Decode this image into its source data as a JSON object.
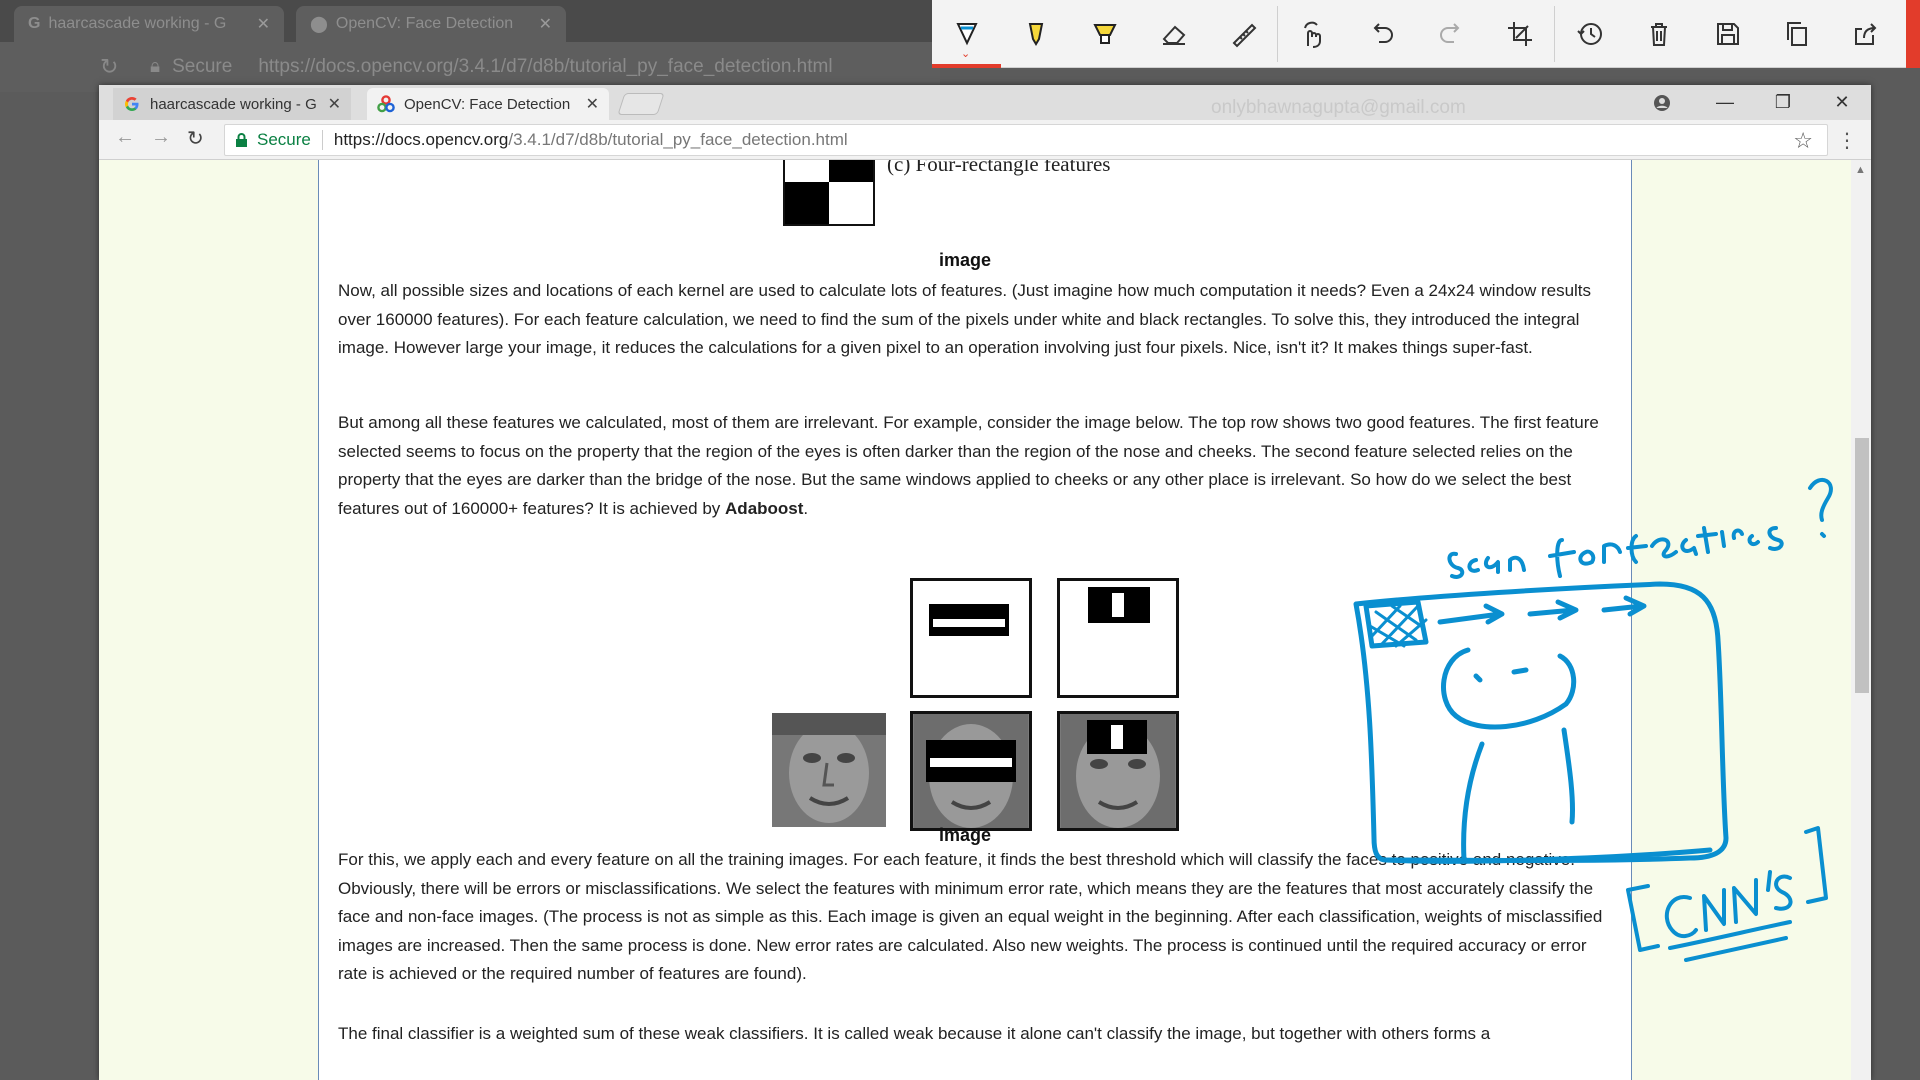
{
  "background_browser": {
    "tabs": [
      {
        "title": "haarcascade working - G"
      },
      {
        "title": "OpenCV: Face Detection"
      }
    ],
    "secure_label": "Secure",
    "url": "https://docs.opencv.org/3.4.1/d7/d8b/tutorial_py_face_detection.html"
  },
  "toolbar": {
    "tools": [
      {
        "icon": "pen-icon",
        "active": true
      },
      {
        "icon": "pencil-highlighter-icon"
      },
      {
        "icon": "highlighter-icon"
      },
      {
        "icon": "eraser-icon"
      },
      {
        "icon": "ruler-icon"
      },
      {
        "icon": "touch-writing-icon"
      },
      {
        "icon": "undo-icon"
      },
      {
        "icon": "redo-icon"
      },
      {
        "icon": "crop-icon"
      },
      {
        "icon": "history-icon"
      },
      {
        "icon": "delete-icon"
      },
      {
        "icon": "save-icon"
      },
      {
        "icon": "copy-icon"
      },
      {
        "icon": "share-icon"
      }
    ],
    "accent_color": "#e23c2b"
  },
  "browser": {
    "tabs": [
      {
        "title": "haarcascade working - G",
        "active": false
      },
      {
        "title": "OpenCV: Face Detection",
        "active": true
      }
    ],
    "profile_email": "onlybhawnagupta@gmail.com",
    "secure_label": "Secure",
    "url_host": "https://docs.opencv.org",
    "url_path": "/3.4.1/d7/d8b/tutorial_py_face_detection.html"
  },
  "page": {
    "top_caption": "(c) Four-rectangle features",
    "caption_1": "image",
    "para_1": "Now, all possible sizes and locations of each kernel are used to calculate lots of features. (Just imagine how much computation it needs? Even a 24x24 window results over 160000 features). For each feature calculation, we need to find the sum of the pixels under white and black rectangles. To solve this, they introduced the integral image. However large your image, it reduces the calculations for a given pixel to an operation involving just four pixels. Nice, isn't it? It makes things super-fast.",
    "para_2": "But among all these features we calculated, most of them are irrelevant. For example, consider the image below. The top row shows two good features. The first feature selected seems to focus on the property that the region of the eyes is often darker than the region of the nose and cheeks. The second feature selected relies on the property that the eyes are darker than the bridge of the nose. But the same windows applied to cheeks or any other place is irrelevant. So how do we select the best features out of 160000+ features? It is achieved by",
    "para_2_bold": "Adaboost",
    "para_2_end": ".",
    "caption_2": "image",
    "para_3": "For this, we apply each and every feature on all the training images. For each feature, it finds the best threshold which will classify the faces to positive and negative. Obviously, there will be errors or misclassifications. We select the features with minimum error rate, which means they are the features that most accurately classify the face and non-face images. (The process is not as simple as this. Each image is given an equal weight in the beginning. After each classification, weights of misclassified images are increased. Then the same process is done. New error rates are calculated. Also new weights. The process is continued until the required accuracy or error rate is achieved or the required number of features are found).",
    "para_4": "The final classifier is a weighted sum of these weak classifiers. It is called weak because it alone can't classify the image, but together with others forms a"
  },
  "annotations": {
    "ink_color": "#0a8fd0",
    "text_1": "scan for features?",
    "text_2": "[CNN's]"
  }
}
